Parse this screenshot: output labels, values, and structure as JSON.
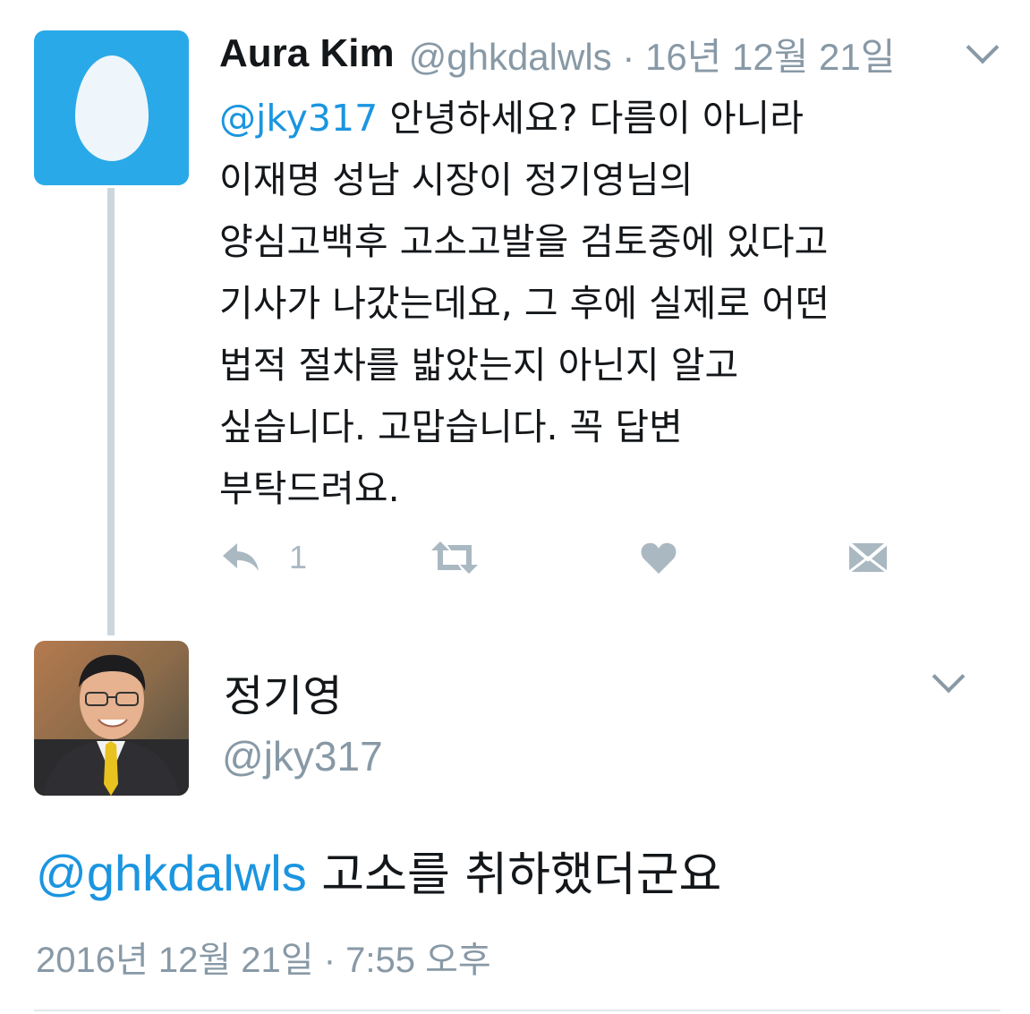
{
  "tweet": {
    "display_name": "Aura Kim",
    "handle_meta": "@ghkdalwls · 16년 12월 21일",
    "avatar_icon": "egg-avatar-icon",
    "lines": [
      {
        "mention": "@jky317",
        "text": " 안녕하세요? 다름이 아니라"
      },
      {
        "mention": "",
        "text": "이재명 성남 시장이 정기영님의"
      },
      {
        "mention": "",
        "text": "양심고백후 고소고발을 검토중에 있다고"
      },
      {
        "mention": "",
        "text": "기사가 나갔는데요, 그 후에 실제로 어떤"
      },
      {
        "mention": "",
        "text": "법적 절차를 밟았는지 아닌지 알고"
      },
      {
        "mention": "",
        "text": "싶습니다. 고맙습니다. 꼭 답변"
      },
      {
        "mention": "",
        "text": "부탁드려요."
      }
    ],
    "actions": {
      "reply_icon": "reply-icon",
      "reply_count": "1",
      "retweet_icon": "retweet-icon",
      "like_icon": "heart-icon",
      "dm_icon": "envelope-icon"
    }
  },
  "reply": {
    "display_name": "정기영",
    "handle": "@jky317",
    "mention": "@ghkdalwls",
    "text": " 고소를  취하했더군요",
    "timestamp": "2016년 12월 21일 · 7:55 오후"
  },
  "colors": {
    "link": "#1b95e0",
    "muted": "#8899a6",
    "egg_bg": "#2aa9e8",
    "thread_line": "#ccd6dd",
    "icon_gray": "#aab8c2"
  }
}
